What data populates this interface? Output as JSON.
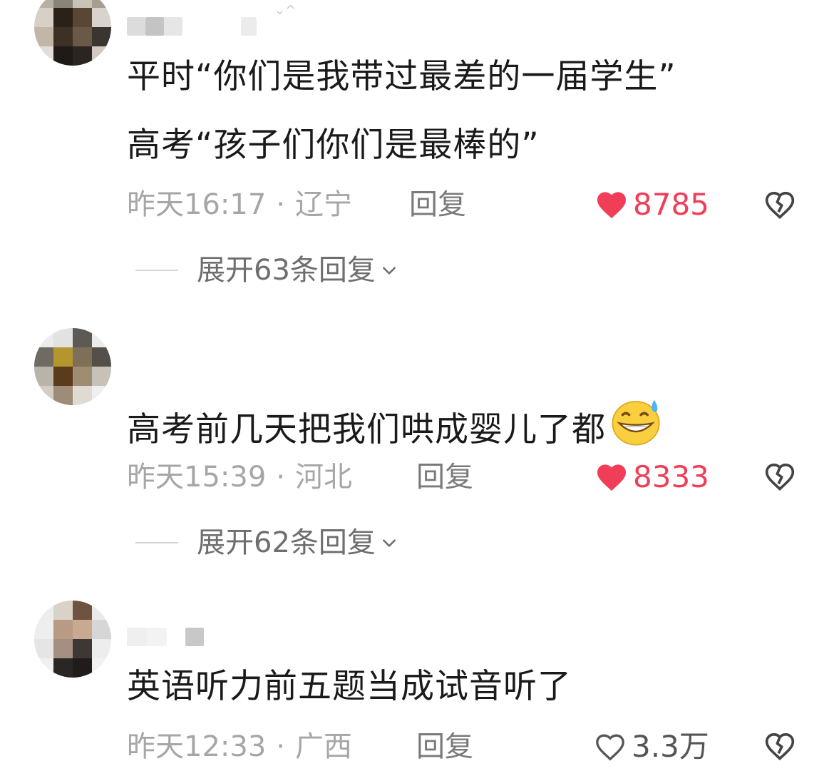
{
  "comments": [
    {
      "text_lines": [
        "平时“你们是我带过最差的一届学生”",
        "高考“孩子们你们是最棒的”"
      ],
      "time": "昨天16:17",
      "location": "辽宁",
      "reply_label": "回复",
      "likes": "8785",
      "liked": true,
      "expand_label": "展开63条回复"
    },
    {
      "text_lines": [
        "高考前几天把我们哄成婴儿了都"
      ],
      "emoji": "grinning-sweat-emoji",
      "time": "昨天15:39",
      "location": "河北",
      "reply_label": "回复",
      "likes": "8333",
      "liked": true,
      "expand_label": "展开62条回复"
    },
    {
      "text_lines": [
        "英语听力前五题当成试音听了"
      ],
      "time": "昨天12:33",
      "location": "广西",
      "reply_label": "回复",
      "likes": "3.3万",
      "liked": false
    }
  ],
  "meta_separator": "·",
  "colors": {
    "like_active": "#f03e59",
    "meta_text": "#a6a6a6",
    "body_text": "#1a1a1a"
  }
}
